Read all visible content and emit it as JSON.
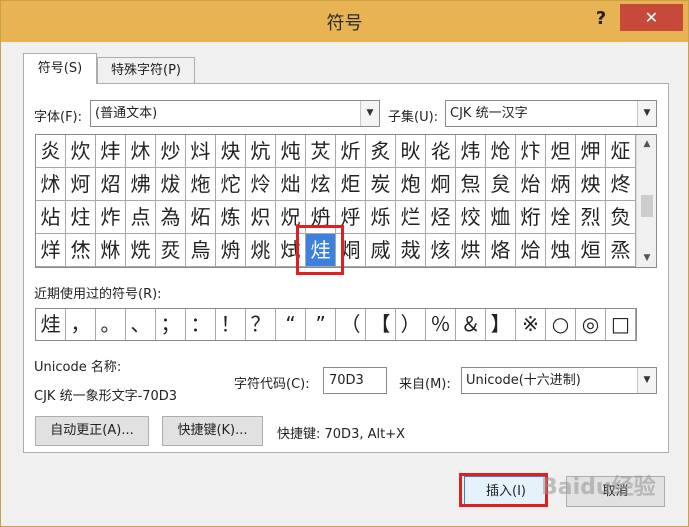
{
  "window": {
    "title": "符号",
    "help": "?",
    "close": "✕"
  },
  "tabs": [
    {
      "label": "符号(S)",
      "active": true
    },
    {
      "label": "特殊字符(P)",
      "active": false
    }
  ],
  "font": {
    "label": "字体(F):",
    "value": "(普通文本)"
  },
  "subset": {
    "label": "子集(U):",
    "value": "CJK 统一汉字"
  },
  "grid": {
    "rows": [
      [
        "炎",
        "炊",
        "炐",
        "炑",
        "炒",
        "炓",
        "炔",
        "炕",
        "炖",
        "炗",
        "炘",
        "炙",
        "炚",
        "炛",
        "炜",
        "炝",
        "炞",
        "炟",
        "炠",
        "炡"
      ],
      [
        "炢",
        "炣",
        "炤",
        "炥",
        "炦",
        "炧",
        "炨",
        "炩",
        "炪",
        "炫",
        "炬",
        "炭",
        "炮",
        "炯",
        "炰",
        "炱",
        "炲",
        "炳",
        "炴",
        "炵"
      ],
      [
        "炶",
        "炷",
        "炸",
        "点",
        "為",
        "炻",
        "炼",
        "炽",
        "炾",
        "炿",
        "烀",
        "烁",
        "烂",
        "烃",
        "烄",
        "烅",
        "烆",
        "烇",
        "烈",
        "烉"
      ],
      [
        "烊",
        "烋",
        "烌",
        "烍",
        "烎",
        "烏",
        "烐",
        "烑",
        "烒",
        "烓",
        "烔",
        "烕",
        "烖",
        "烗",
        "烘",
        "烙",
        "烚",
        "烛",
        "烜",
        "烝"
      ]
    ],
    "selected_index": 69
  },
  "recent": {
    "label": "近期使用过的符号(R):",
    "items": [
      "烓",
      "，",
      "。",
      "、",
      "；",
      "：",
      "！",
      "？",
      "“",
      "”",
      "（",
      "【",
      "）",
      "％",
      "＆",
      "】",
      "※",
      "○",
      "◎",
      "□"
    ]
  },
  "unicode_name": {
    "label": "Unicode 名称:",
    "value": "CJK 统一象形文字-70D3"
  },
  "char_code": {
    "label": "字符代码(C):",
    "value": "70D3"
  },
  "from": {
    "label": "来自(M):",
    "value": "Unicode(十六进制)"
  },
  "buttons": {
    "autocorrect": "自动更正(A)...",
    "shortcut_key": "快捷键(K)...",
    "insert": "插入(I)",
    "cancel": "取消"
  },
  "shortcut_info": "快捷键: 70D3, Alt+X",
  "watermark": "Baidu经验"
}
